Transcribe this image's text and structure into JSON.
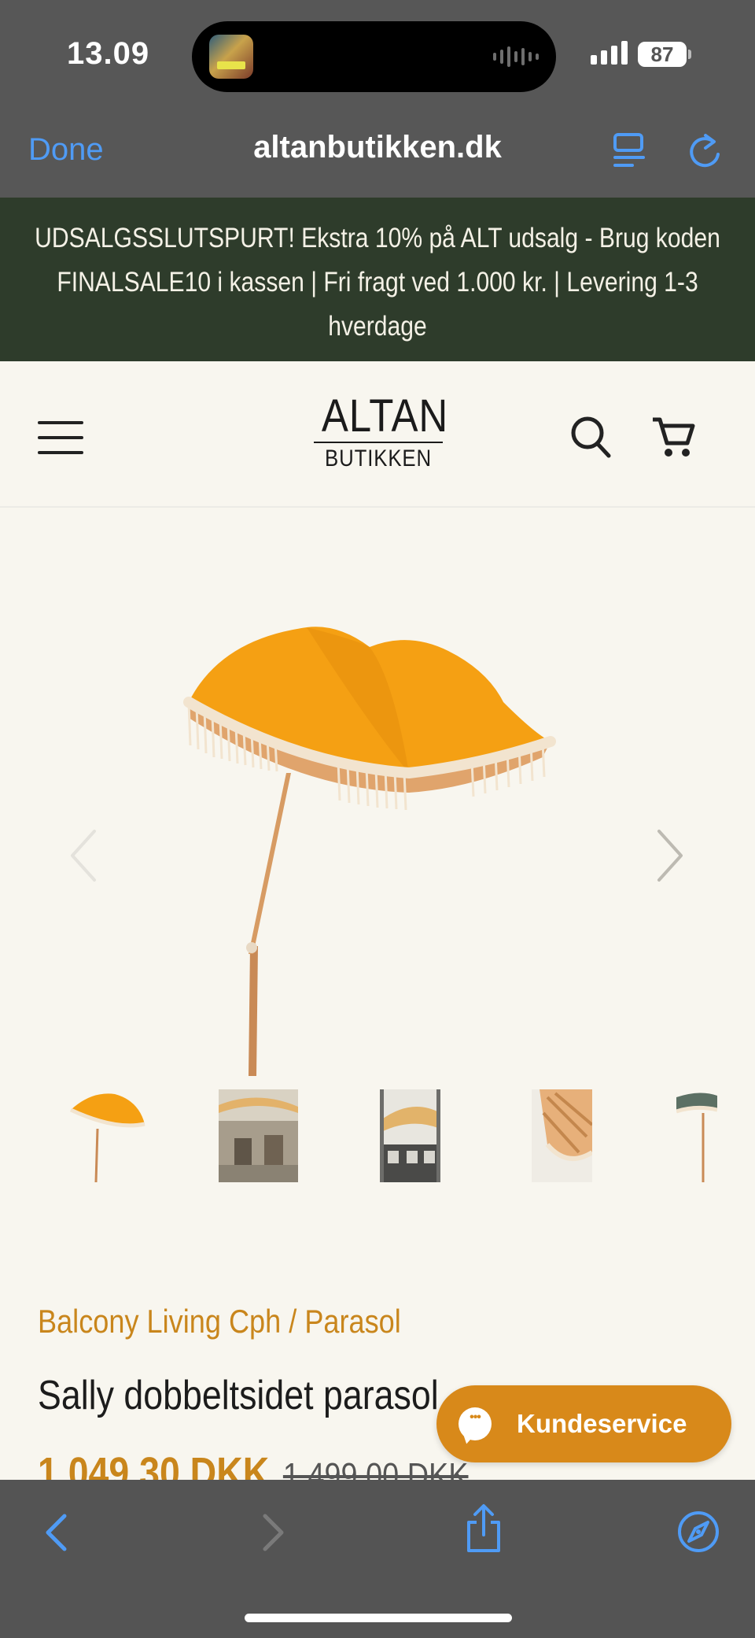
{
  "status_bar": {
    "time": "13.09",
    "battery": "87"
  },
  "browser": {
    "done_label": "Done",
    "url": "altanbutikken.dk"
  },
  "promo": {
    "text": "UDSALGSSLUTSPURT! Ekstra 10% på ALT udsalg - Brug koden FINALSALE10 i kassen | Fri fragt ved 1.000 kr. | Levering 1-3 hverdage"
  },
  "header": {
    "logo_top": "ALTAN",
    "logo_bottom": "BUTIKKEN"
  },
  "gallery": {
    "thumbnail_count": 5
  },
  "product": {
    "breadcrumb": "Balcony Living Cph / Parasol",
    "title": "Sally dobbeltsidet parasol",
    "price_sale": "1.049,30 DKK",
    "price_original": "1.499,00 DKK"
  },
  "support": {
    "label": "Kundeservice"
  },
  "colors": {
    "accent": "#c9861c",
    "banner_bg": "#2e3c2b",
    "browser_blue": "#4f9bf5",
    "page_bg": "#f8f6ef"
  }
}
